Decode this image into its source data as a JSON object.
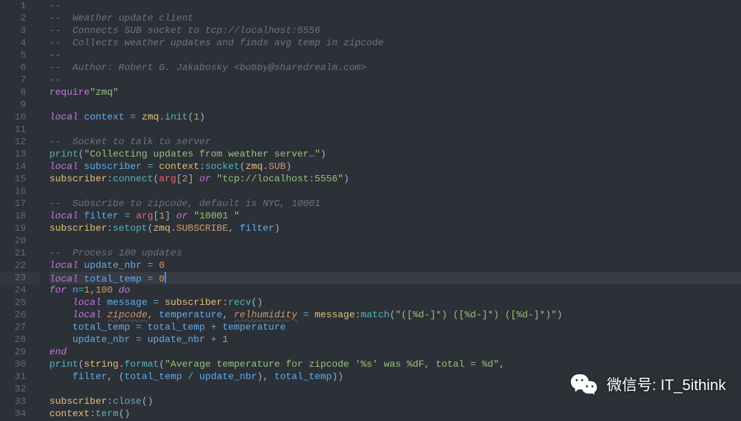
{
  "watermark": {
    "label_prefix": "微信号: ",
    "handle": "IT_5ithink"
  },
  "line_count": 34,
  "code": {
    "l1": [
      [
        "--",
        "cmt"
      ]
    ],
    "l2": [
      [
        "--  Weather update client",
        "cmt"
      ]
    ],
    "l3": [
      [
        "--  Connects SUB socket to tcp://localhost:5556",
        "cmt"
      ]
    ],
    "l4": [
      [
        "--  Collects weather updates and finds avg temp in zipcode",
        "cmt"
      ]
    ],
    "l5": [
      [
        "--",
        "cmt"
      ]
    ],
    "l6": [
      [
        "--  Author: Robert G. Jakabosky <bobby@sharedrealm.com>",
        "cmt"
      ]
    ],
    "l7": [
      [
        "--",
        "cmt"
      ]
    ],
    "l8": [
      [
        "require",
        "req"
      ],
      [
        "\"zmq\"",
        "str"
      ]
    ],
    "l9": [],
    "l10": [
      [
        "local ",
        "kw"
      ],
      [
        "context",
        "var"
      ],
      [
        " ",
        "punc"
      ],
      [
        "=",
        "op"
      ],
      [
        " ",
        "punc"
      ],
      [
        "zmq",
        "id"
      ],
      [
        ".",
        "punc"
      ],
      [
        "init",
        "func"
      ],
      [
        "(",
        "punc"
      ],
      [
        "1",
        "num"
      ],
      [
        ")",
        "punc"
      ]
    ],
    "l11": [],
    "l12": [
      [
        "--  Socket to talk to server",
        "cmt"
      ]
    ],
    "l13": [
      [
        "print",
        "func"
      ],
      [
        "(",
        "punc"
      ],
      [
        "\"Collecting updates from weather server…\"",
        "str"
      ],
      [
        ")",
        "punc"
      ]
    ],
    "l14": [
      [
        "local ",
        "kw"
      ],
      [
        "subscriber",
        "var"
      ],
      [
        " ",
        "punc"
      ],
      [
        "=",
        "op"
      ],
      [
        " ",
        "punc"
      ],
      [
        "context",
        "id"
      ],
      [
        ":",
        "punc"
      ],
      [
        "socket",
        "func"
      ],
      [
        "(",
        "punc"
      ],
      [
        "zmq",
        "id"
      ],
      [
        ".",
        "punc"
      ],
      [
        "SUB",
        "prop"
      ],
      [
        ")",
        "punc"
      ]
    ],
    "l15": [
      [
        "subscriber",
        "id"
      ],
      [
        ":",
        "punc"
      ],
      [
        "connect",
        "func"
      ],
      [
        "(",
        "punc"
      ],
      [
        "arg",
        "def"
      ],
      [
        "[",
        "punc"
      ],
      [
        "2",
        "num"
      ],
      [
        "] ",
        "punc"
      ],
      [
        "or ",
        "kw"
      ],
      [
        "\"tcp://localhost:5556\"",
        "str"
      ],
      [
        ")",
        "punc"
      ]
    ],
    "l16": [],
    "l17": [
      [
        "--  Subscribe to zipcode, default is NYC, 10001",
        "cmt"
      ]
    ],
    "l18": [
      [
        "local ",
        "kw"
      ],
      [
        "filter",
        "var"
      ],
      [
        " ",
        "punc"
      ],
      [
        "=",
        "op"
      ],
      [
        " ",
        "punc"
      ],
      [
        "arg",
        "def"
      ],
      [
        "[",
        "punc"
      ],
      [
        "1",
        "num"
      ],
      [
        "] ",
        "punc"
      ],
      [
        "or ",
        "kw"
      ],
      [
        "\"10001 \"",
        "str"
      ]
    ],
    "l19": [
      [
        "subscriber",
        "id"
      ],
      [
        ":",
        "punc"
      ],
      [
        "setopt",
        "func"
      ],
      [
        "(",
        "punc"
      ],
      [
        "zmq",
        "id"
      ],
      [
        ".",
        "punc"
      ],
      [
        "SUBSCRIBE",
        "prop"
      ],
      [
        ", ",
        "punc"
      ],
      [
        "filter",
        "var"
      ],
      [
        ")",
        "punc"
      ]
    ],
    "l20": [],
    "l21": [
      [
        "--  Process 100 updates",
        "cmt"
      ]
    ],
    "l22": [
      [
        "local ",
        "kw"
      ],
      [
        "update_nbr",
        "var"
      ],
      [
        " ",
        "punc"
      ],
      [
        "=",
        "op"
      ],
      [
        " ",
        "punc"
      ],
      [
        "0",
        "num"
      ]
    ],
    "l23": [
      [
        "local ",
        "kw"
      ],
      [
        "total_temp",
        "var"
      ],
      [
        " ",
        "punc"
      ],
      [
        "=",
        "op"
      ],
      [
        " ",
        "punc"
      ],
      [
        "0",
        "num"
      ]
    ],
    "l24": [
      [
        "for ",
        "kw"
      ],
      [
        "n",
        "var"
      ],
      [
        "=",
        "op"
      ],
      [
        "1",
        "num"
      ],
      [
        ",",
        "punc"
      ],
      [
        "100",
        "num"
      ],
      [
        " do",
        "kw"
      ]
    ],
    "l25": [
      [
        "    ",
        "punc"
      ],
      [
        "local ",
        "kw"
      ],
      [
        "message",
        "var"
      ],
      [
        " ",
        "punc"
      ],
      [
        "=",
        "op"
      ],
      [
        " ",
        "punc"
      ],
      [
        "subscriber",
        "id"
      ],
      [
        ":",
        "punc"
      ],
      [
        "recv",
        "func"
      ],
      [
        "()",
        "punc"
      ]
    ],
    "l26": [
      [
        "    ",
        "punc"
      ],
      [
        "local ",
        "kw"
      ],
      [
        "zipcode",
        "param"
      ],
      [
        ", ",
        "punc"
      ],
      [
        "temperature",
        "var"
      ],
      [
        ", ",
        "punc"
      ],
      [
        "relhumidity",
        "param"
      ],
      [
        " ",
        "punc"
      ],
      [
        "=",
        "op"
      ],
      [
        " ",
        "punc"
      ],
      [
        "message",
        "id"
      ],
      [
        ":",
        "punc"
      ],
      [
        "match",
        "func"
      ],
      [
        "(",
        "punc"
      ],
      [
        "\"([%d-]*) ([%d-]*) ([%d-]*)\"",
        "str"
      ],
      [
        ")",
        "punc"
      ]
    ],
    "l27": [
      [
        "    ",
        "punc"
      ],
      [
        "total_temp",
        "var"
      ],
      [
        " ",
        "punc"
      ],
      [
        "=",
        "op"
      ],
      [
        " ",
        "punc"
      ],
      [
        "total_temp",
        "var"
      ],
      [
        " ",
        "punc"
      ],
      [
        "+",
        "op"
      ],
      [
        " ",
        "punc"
      ],
      [
        "temperature",
        "var"
      ]
    ],
    "l28": [
      [
        "    ",
        "punc"
      ],
      [
        "update_nbr",
        "var"
      ],
      [
        " ",
        "punc"
      ],
      [
        "=",
        "op"
      ],
      [
        " ",
        "punc"
      ],
      [
        "update_nbr",
        "var"
      ],
      [
        " ",
        "punc"
      ],
      [
        "+",
        "op"
      ],
      [
        " ",
        "punc"
      ],
      [
        "1",
        "num"
      ]
    ],
    "l29": [
      [
        "end",
        "kw"
      ]
    ],
    "l30": [
      [
        "print",
        "func"
      ],
      [
        "(",
        "punc"
      ],
      [
        "string",
        "id"
      ],
      [
        ".",
        "punc"
      ],
      [
        "format",
        "func"
      ],
      [
        "(",
        "punc"
      ],
      [
        "\"Average temperature for zipcode '%s' was %dF, total = %d\"",
        "str"
      ],
      [
        ",",
        "punc"
      ]
    ],
    "l31": [
      [
        "    ",
        "punc"
      ],
      [
        "filter",
        "var"
      ],
      [
        ", (",
        "punc"
      ],
      [
        "total_temp",
        "var"
      ],
      [
        " ",
        "punc"
      ],
      [
        "/",
        "op"
      ],
      [
        " ",
        "punc"
      ],
      [
        "update_nbr",
        "var"
      ],
      [
        "), ",
        "punc"
      ],
      [
        "total_temp",
        "var"
      ],
      [
        "))",
        "punc"
      ]
    ],
    "l32": [],
    "l33": [
      [
        "subscriber",
        "id"
      ],
      [
        ":",
        "punc"
      ],
      [
        "close",
        "func"
      ],
      [
        "()",
        "punc"
      ]
    ],
    "l34": [
      [
        "context",
        "id"
      ],
      [
        ":",
        "punc"
      ],
      [
        "term",
        "func"
      ],
      [
        "()",
        "punc"
      ]
    ]
  },
  "highlighted_line": 23
}
